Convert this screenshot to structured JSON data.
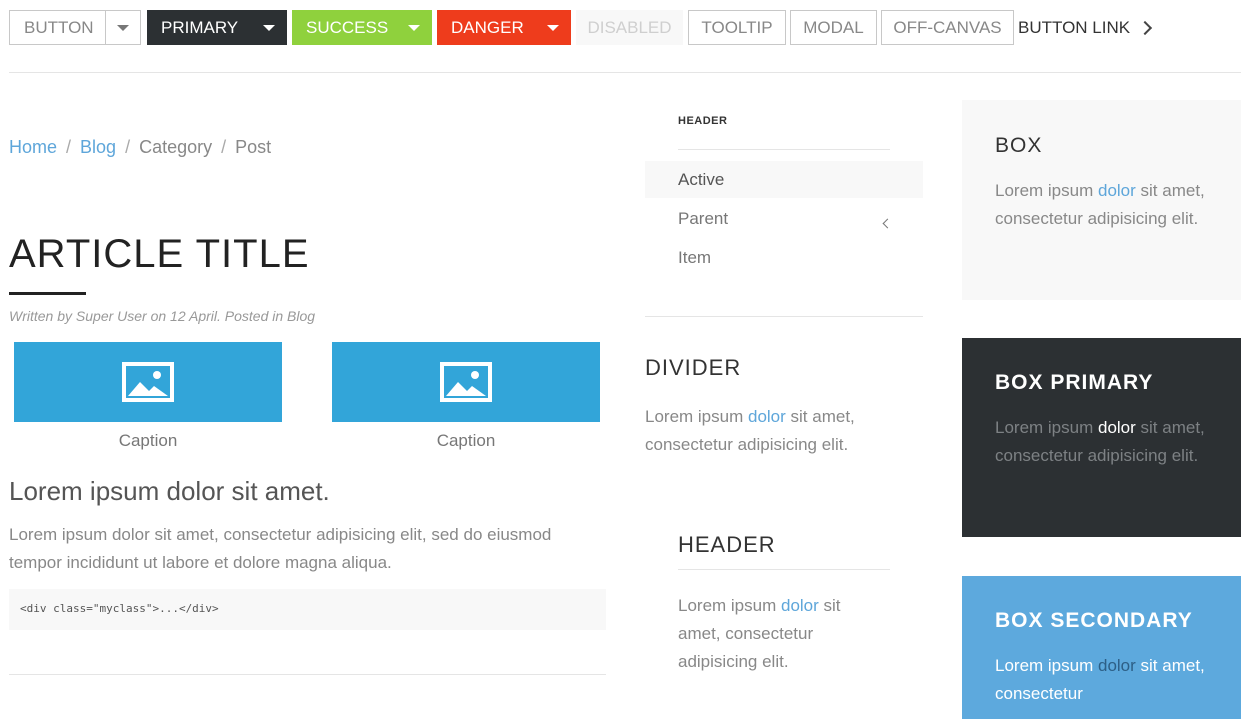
{
  "toolbar": {
    "button": "BUTTON",
    "primary": "PRIMARY",
    "success": "SUCCESS",
    "danger": "DANGER",
    "disabled": "DISABLED",
    "tooltip": "TOOLTIP",
    "modal": "MODAL",
    "offcanvas": "OFF-CANVAS",
    "link": "BUTTON LINK"
  },
  "breadcrumb": {
    "items": [
      "Home",
      "Blog",
      "Category",
      "Post"
    ],
    "separator": "/"
  },
  "article": {
    "title": "ARTICLE TITLE",
    "meta": "Written by Super User on 12 April. Posted in Blog",
    "images": [
      {
        "icon": "image-icon",
        "caption": "Caption"
      },
      {
        "icon": "image-icon",
        "caption": "Caption"
      }
    ],
    "lead": "Lorem ipsum dolor sit amet.",
    "body": "Lorem ipsum dolor sit amet, consectetur adipisicing elit, sed do eiusmod tempor incididunt ut labore et dolore magna aliqua.",
    "code": "<div class=\"myclass\">...</div>"
  },
  "nav": {
    "header": "HEADER",
    "items": [
      {
        "label": "Active",
        "active": true
      },
      {
        "label": "Parent",
        "icon": "chevron-left-icon"
      },
      {
        "label": "Item"
      }
    ]
  },
  "divider_panel": {
    "title": "DIVIDER",
    "text_before": "Lorem ipsum ",
    "link": "dolor",
    "text_after": " sit amet, consectetur adipisicing elit."
  },
  "header_panel": {
    "title": "HEADER",
    "text_before": "Lorem ipsum ",
    "link": "dolor",
    "text_after": " sit amet, consectetur adipisicing elit."
  },
  "boxes": [
    {
      "title": "BOX",
      "text_before": "Lorem ipsum ",
      "link": "dolor",
      "text_after": " sit amet, consectetur adipisicing elit."
    },
    {
      "title": "BOX PRIMARY",
      "text_before": "Lorem ipsum ",
      "link": "dolor",
      "text_after": " sit amet, consectetur adipisicing elit."
    },
    {
      "title": "BOX SECONDARY",
      "text_before": "Lorem ipsum ",
      "link": "dolor",
      "text_after": " sit amet, consectetur"
    }
  ],
  "colors": {
    "primary": "#2c3033",
    "success": "#8fd13d",
    "danger": "#ee3c1c",
    "link": "#5ea6da",
    "image": "#32a5d9",
    "box_secondary": "#5da9dd",
    "box_muted": "#f8f8f8"
  }
}
